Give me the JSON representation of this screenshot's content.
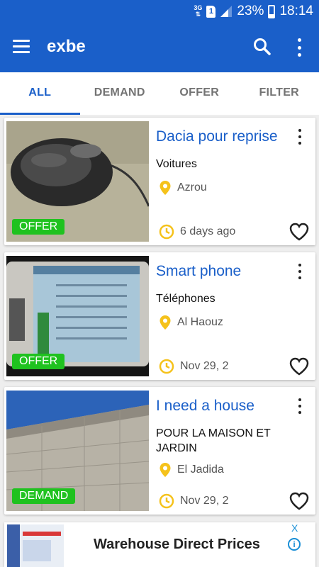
{
  "status_bar": {
    "network": "3G",
    "sim": "1",
    "battery": "23%",
    "time": "18:14"
  },
  "app_bar": {
    "title": "exbe",
    "icons": [
      "menu-icon",
      "search-icon",
      "more-vert-icon"
    ]
  },
  "tabs": [
    {
      "label": "ALL",
      "active": true
    },
    {
      "label": "DEMAND",
      "active": false
    },
    {
      "label": "OFFER",
      "active": false
    },
    {
      "label": "FILTER",
      "active": false
    }
  ],
  "listings": [
    {
      "title": "Dacia pour reprise",
      "category": "Voitures",
      "location": "Azrou",
      "time": "6 days ago",
      "badge": "OFFER",
      "image": "computer-mouse-photo"
    },
    {
      "title": "Smart phone",
      "category": "Téléphones",
      "location": "Al Haouz",
      "time": "Nov 29, 2",
      "badge": "OFFER",
      "image": "samsung-phone-photo"
    },
    {
      "title": "I need a house",
      "category": "POUR LA MAISON ET JARDIN",
      "location": "El Jadida",
      "time": "Nov 29, 2",
      "badge": "DEMAND",
      "image": "concrete-wall-photo"
    }
  ],
  "ad": {
    "text": "Warehouse Direct Prices",
    "info_icon": "i",
    "close_icon": "X"
  },
  "colors": {
    "primary": "#1a5fc9",
    "badge_green": "#1fc21f",
    "accent_yellow": "#f5c21b",
    "background": "#eeeeee"
  }
}
